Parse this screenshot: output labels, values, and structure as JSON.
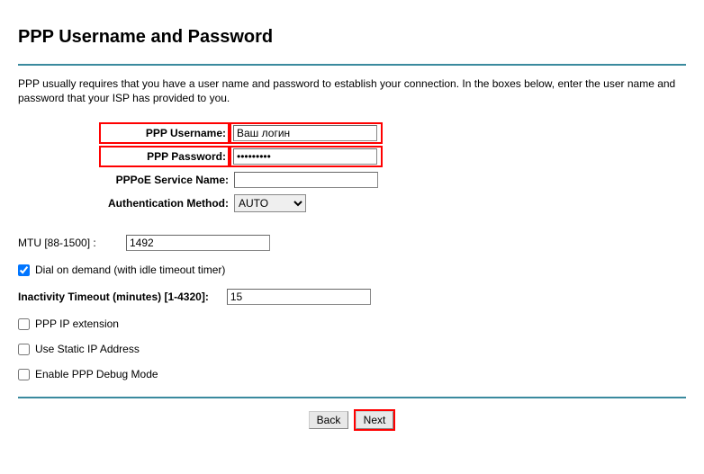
{
  "title": "PPP Username and Password",
  "intro": "PPP usually requires that you have a user name and password to establish your connection. In the boxes below, enter the user name and password that your ISP has provided to you.",
  "labels": {
    "username": "PPP Username:",
    "password": "PPP Password:",
    "service": "PPPoE Service Name:",
    "auth": "Authentication Method:",
    "mtu": "MTU [88-1500] :",
    "dial_on_demand": "Dial on demand (with idle timeout timer)",
    "inactivity": "Inactivity Timeout (minutes) [1-4320]:",
    "ppp_ip_ext": "PPP IP extension",
    "static_ip": "Use Static IP Address",
    "debug": "Enable PPP Debug Mode"
  },
  "values": {
    "username": "Ваш логин",
    "password": "•••••••••",
    "service": "",
    "auth": "AUTO",
    "mtu": "1492",
    "dial_on_demand_checked": true,
    "inactivity": "15",
    "ppp_ip_ext_checked": false,
    "static_ip_checked": false,
    "debug_checked": false
  },
  "options": {
    "auth": [
      "AUTO"
    ]
  },
  "buttons": {
    "back": "Back",
    "next": "Next"
  }
}
